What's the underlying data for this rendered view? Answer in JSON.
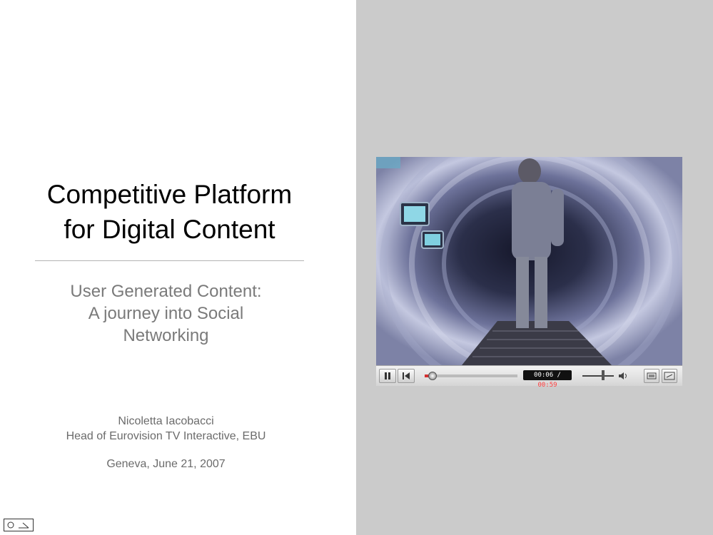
{
  "slide": {
    "title_line1": "Competitive Platform",
    "title_line2": "for Digital Content",
    "subtitle_line1": "User Generated Content:",
    "subtitle_line2": "A journey into Social",
    "subtitle_line3": "Networking",
    "author_name": "Nicoletta Iacobacci",
    "author_role": "Head of Eurovision TV Interactive, EBU",
    "date": "Geneva, June 21, 2007"
  },
  "player": {
    "time_current": "00:06",
    "time_separator": " / ",
    "time_total": "00:59",
    "progress": 0.08,
    "volume": 0.65
  },
  "colors": {
    "right_panel": "#cbcbcb",
    "progress_red": "#d43030",
    "subtitle_gray": "#7a7a7a"
  }
}
